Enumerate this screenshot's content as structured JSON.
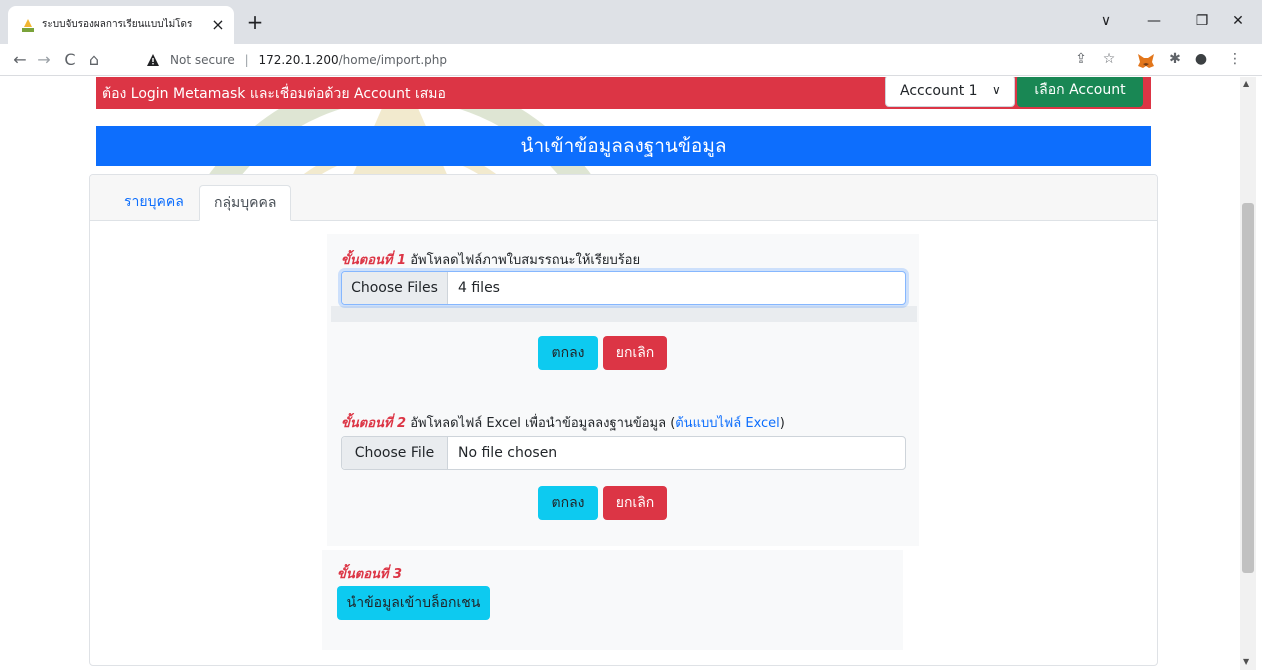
{
  "browser": {
    "tab_title": "ระบบจับรองผลการเรียนแบบไม่โดร",
    "tab_close": "×",
    "new_tab": "+",
    "window_controls": {
      "dropdown": "∨",
      "minimize": "—",
      "restore": "❐",
      "close": "✕"
    },
    "nav": {
      "back": "←",
      "forward": "→",
      "reload": "C",
      "home": "⌂"
    },
    "security_label": "Not secure",
    "url_separator": "|",
    "url_host": "172.20.1.200",
    "url_path": "/home/import.php",
    "icons": [
      "share-icon",
      "star-icon",
      "metamask-icon",
      "puzzle-icon",
      "profile-icon",
      "menu-icon"
    ],
    "toolbar_glyphs": {
      "share": "⇪",
      "star": "☆",
      "puzzle": "✱",
      "profile": "●",
      "menu": "⋮"
    }
  },
  "alert": {
    "message": "ต้อง Login Metamask และเชื่อมต่อด้วย Account เสมอ",
    "account_select_value": "Acccount 1",
    "select_caret": "∨",
    "select_account_button": "เลือก Account"
  },
  "page": {
    "title": "นำเข้าข้อมูลลงฐานข้อมูล",
    "tabs": [
      {
        "label": "รายบุคคล",
        "active": false
      },
      {
        "label": "กลุ่มบุคคล",
        "active": true
      }
    ]
  },
  "step1": {
    "label_step": "ขั้นตอนที่ 1",
    "label_text": " อัพโหลดไฟล์ภาพใบสมรรถนะให้เรียบร้อย",
    "choose_button": "Choose Files",
    "file_value": "4 files",
    "ok_button": "ตกลง",
    "cancel_button": "ยกเลิก"
  },
  "step2": {
    "label_step": "ขั้นตอนที่ 2",
    "label_text": " อัพโหลดไฟล์ Excel เพื่อนำข้อมูลลงฐานข้อมูล (",
    "template_link": "ต้นแบบไฟล์ Excel",
    "label_close": ")",
    "choose_button": "Choose File",
    "file_value": "No file chosen",
    "ok_button": "ตกลง",
    "cancel_button": "ยกเลิก"
  },
  "step3": {
    "label_step": "ขั้นตอนที่ 3",
    "blockchain_button": "นำข้อมูลเข้าบล็อกเชน"
  },
  "scrollbar": {
    "up": "▲",
    "down": "▼"
  },
  "colors": {
    "alert": "#dc3545",
    "primary": "#0d6efd",
    "success": "#198754",
    "info": "#0dcaf0",
    "danger": "#dc3545",
    "watermark": "#6b8e3a"
  }
}
